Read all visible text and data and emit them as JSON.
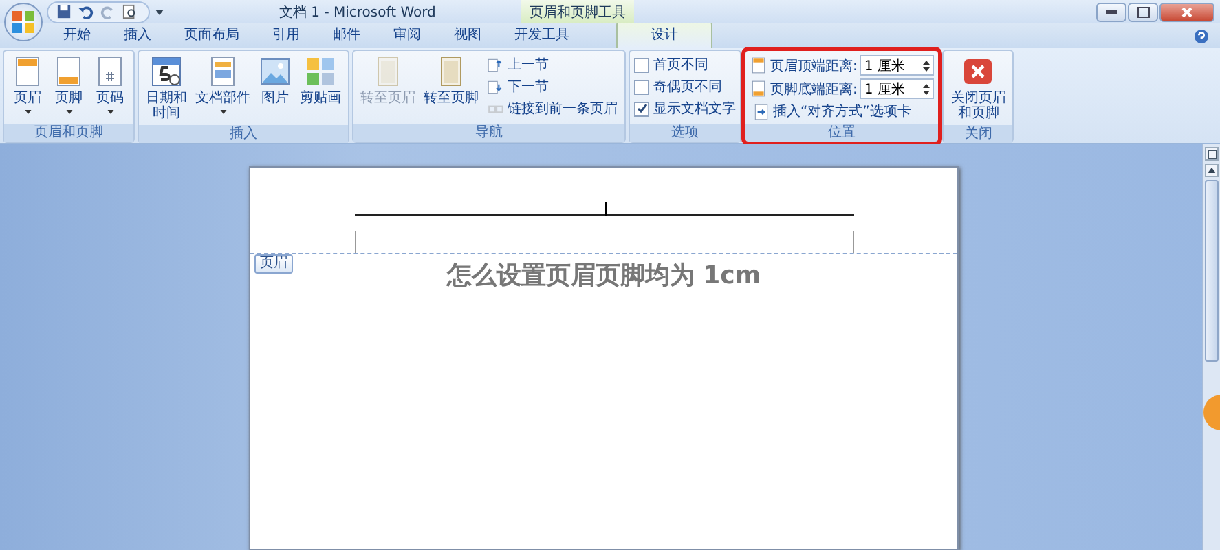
{
  "window": {
    "title": "文档 1 - Microsoft Word",
    "context_tool": "页眉和页脚工具"
  },
  "tabs": [
    {
      "label": "开始",
      "selected": false
    },
    {
      "label": "插入",
      "selected": false
    },
    {
      "label": "页面布局",
      "selected": false
    },
    {
      "label": "引用",
      "selected": false
    },
    {
      "label": "邮件",
      "selected": false
    },
    {
      "label": "审阅",
      "selected": false
    },
    {
      "label": "视图",
      "selected": false
    },
    {
      "label": "开发工具",
      "selected": false
    },
    {
      "label": "设计",
      "selected": true
    }
  ],
  "ribbon": {
    "groups": [
      {
        "label": "页眉和页脚",
        "highlighted": false,
        "items": [
          {
            "kind": "large",
            "label": [
              "页眉"
            ],
            "dropdown": true,
            "disabled": false
          },
          {
            "kind": "large",
            "label": [
              "页脚"
            ],
            "dropdown": true,
            "disabled": false
          },
          {
            "kind": "large",
            "label": [
              "页码"
            ],
            "dropdown": true,
            "disabled": false
          }
        ]
      },
      {
        "label": "插入",
        "highlighted": false,
        "items": [
          {
            "kind": "large",
            "label": [
              "日期和",
              "时间"
            ],
            "dropdown": false,
            "disabled": false
          },
          {
            "kind": "large",
            "label": [
              "文档部件"
            ],
            "dropdown": true,
            "disabled": false
          },
          {
            "kind": "large",
            "label": [
              "图片"
            ],
            "dropdown": false,
            "disabled": false
          },
          {
            "kind": "large",
            "label": [
              "剪贴画"
            ],
            "dropdown": false,
            "disabled": false
          }
        ]
      },
      {
        "label": "导航",
        "highlighted": false,
        "items": [
          {
            "kind": "large",
            "label": [
              "转至页眉"
            ],
            "dropdown": false,
            "disabled": true
          },
          {
            "kind": "large",
            "label": [
              "转至页脚"
            ],
            "dropdown": false,
            "disabled": false
          },
          {
            "kind": "stack",
            "items": [
              {
                "kind": "small",
                "label": "上一节",
                "disabled": false
              },
              {
                "kind": "small",
                "label": "下一节",
                "disabled": false
              },
              {
                "kind": "small",
                "label": "链接到前一条页眉",
                "disabled": true
              }
            ]
          }
        ]
      },
      {
        "label": "选项",
        "highlighted": false,
        "items": [
          {
            "kind": "stack",
            "items": [
              {
                "kind": "checkbox",
                "label": "首页不同",
                "checked": false
              },
              {
                "kind": "checkbox",
                "label": "奇偶页不同",
                "checked": false
              },
              {
                "kind": "checkbox",
                "label": "显示文档文字",
                "checked": true
              }
            ]
          }
        ]
      },
      {
        "label": "位置",
        "highlighted": true,
        "items": [
          {
            "kind": "stack",
            "items": [
              {
                "kind": "spinner",
                "label": "页眉顶端距离:",
                "value": "1 厘米"
              },
              {
                "kind": "spinner",
                "label": "页脚底端距离:",
                "value": "1 厘米"
              },
              {
                "kind": "small",
                "label": "插入“对齐方式”选项卡",
                "disabled": false
              }
            ]
          }
        ]
      },
      {
        "label": "关闭",
        "highlighted": false,
        "items": [
          {
            "kind": "large",
            "label": [
              "关闭页眉",
              "和页脚"
            ],
            "dropdown": false,
            "disabled": false
          }
        ]
      }
    ]
  },
  "document": {
    "header_tag": "页眉",
    "body_text": "怎么设置页眉页脚均为 1cm"
  }
}
